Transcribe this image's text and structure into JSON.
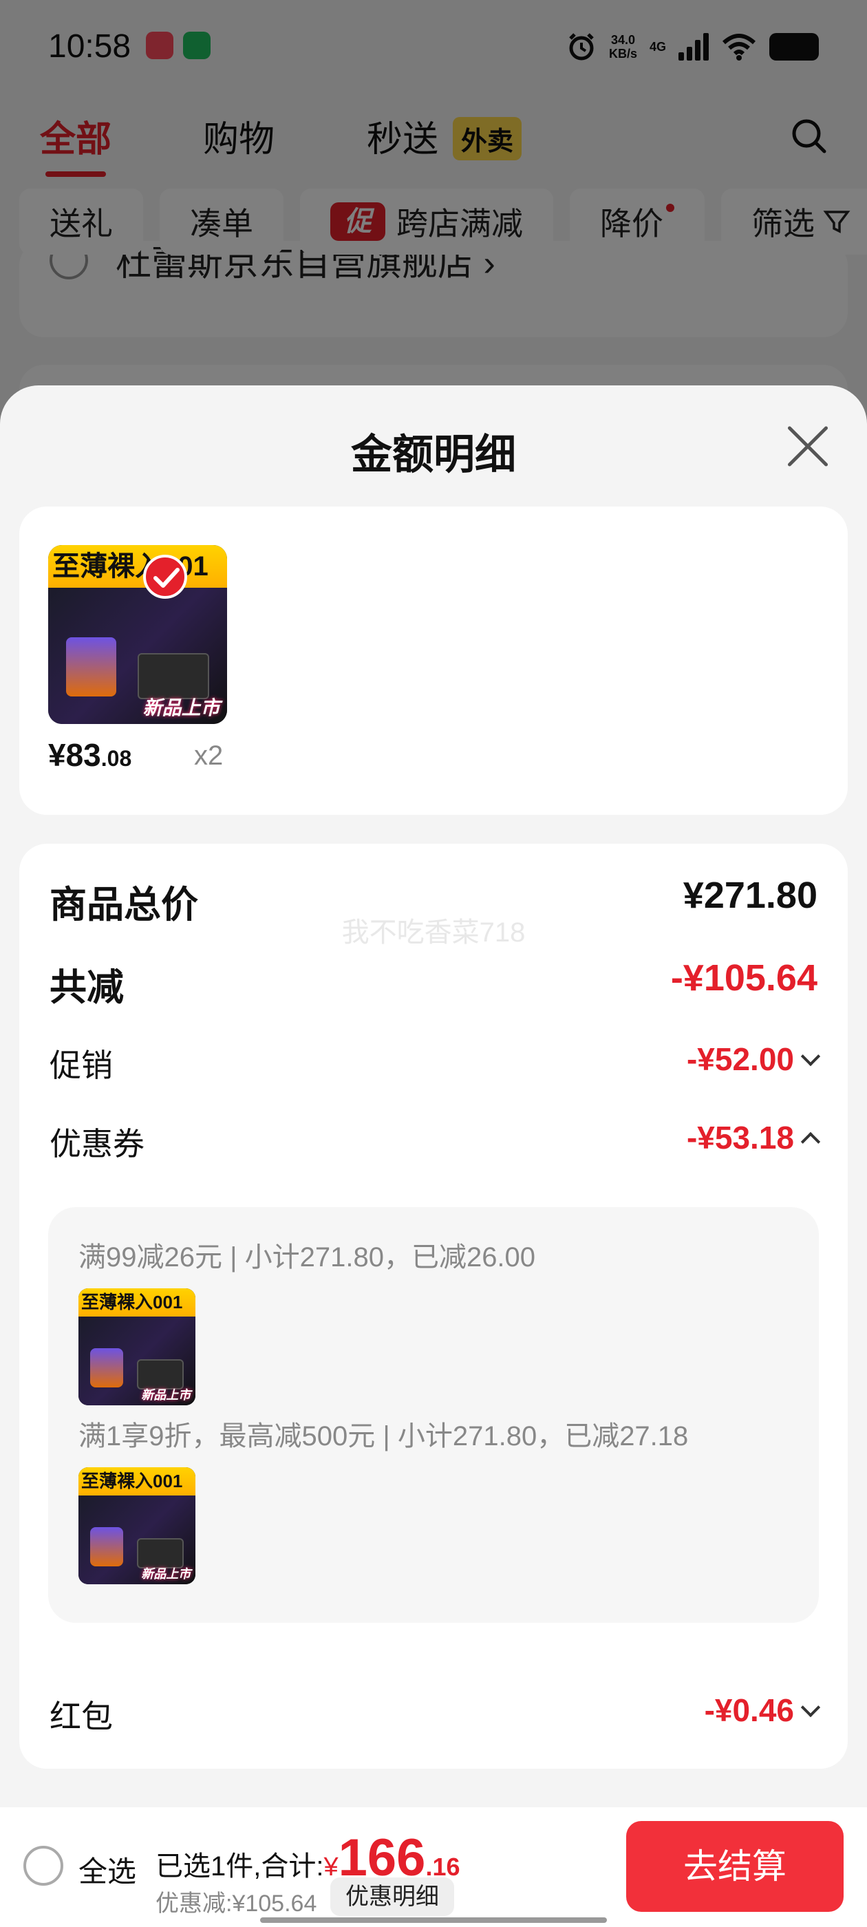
{
  "status_bar": {
    "time": "10:58",
    "net_speed_value": "34.0",
    "net_speed_unit": "KB/s",
    "network": "4G",
    "icons": [
      "shopping-app-icon",
      "wechat-icon",
      "alarm-icon",
      "signal-icon",
      "wifi-icon",
      "battery-icon"
    ]
  },
  "header": {
    "tabs": [
      {
        "label": "全部",
        "active": true
      },
      {
        "label": "购物",
        "active": false
      },
      {
        "label": "秒送",
        "active": false
      }
    ],
    "waimai_badge": "外卖"
  },
  "filters": {
    "chips": [
      {
        "label": "送礼"
      },
      {
        "label": "凑单"
      },
      {
        "label": "跨店满减",
        "badge": "促"
      },
      {
        "label": "降价",
        "dot": true
      },
      {
        "label": "筛选"
      }
    ]
  },
  "background_shop": {
    "name": "杜蕾斯京东自营旗舰店 ›"
  },
  "sheet": {
    "title": "金额明细",
    "product": {
      "thumb_banner": "至薄裸入001",
      "thumb_tag": "新品上市",
      "price_int": "¥83",
      "price_dec": ".08",
      "qty": "x2"
    },
    "watermark": "我不吃香菜718",
    "rows": {
      "total": {
        "label": "商品总价",
        "value": "¥271.80"
      },
      "reduced": {
        "label": "共减",
        "value": "-¥105.64"
      },
      "promo": {
        "label": "促销",
        "value": "-¥52.00"
      },
      "coupon": {
        "label": "优惠券",
        "value": "-¥53.18"
      },
      "redpacket": {
        "label": "红包",
        "value": "-¥0.46"
      }
    },
    "coupon_details": [
      {
        "text": "满99减26元 | 小计271.80，已减26.00"
      },
      {
        "text": "满1享9折，最高减500元 | 小计271.80，已减27.18"
      }
    ]
  },
  "bottom_bar": {
    "select_all": "全选",
    "summary_prefix": "已选1件,合计:",
    "currency": "¥",
    "amount_int": "166",
    "amount_dec": ".16",
    "discount_text": "优惠减:¥105.64",
    "detail_link": "优惠明细",
    "checkout": "去结算"
  },
  "colors": {
    "accent_red": "#e4202b",
    "checkout_red": "#f2303a",
    "waimai_yellow": "#ffd84d"
  }
}
